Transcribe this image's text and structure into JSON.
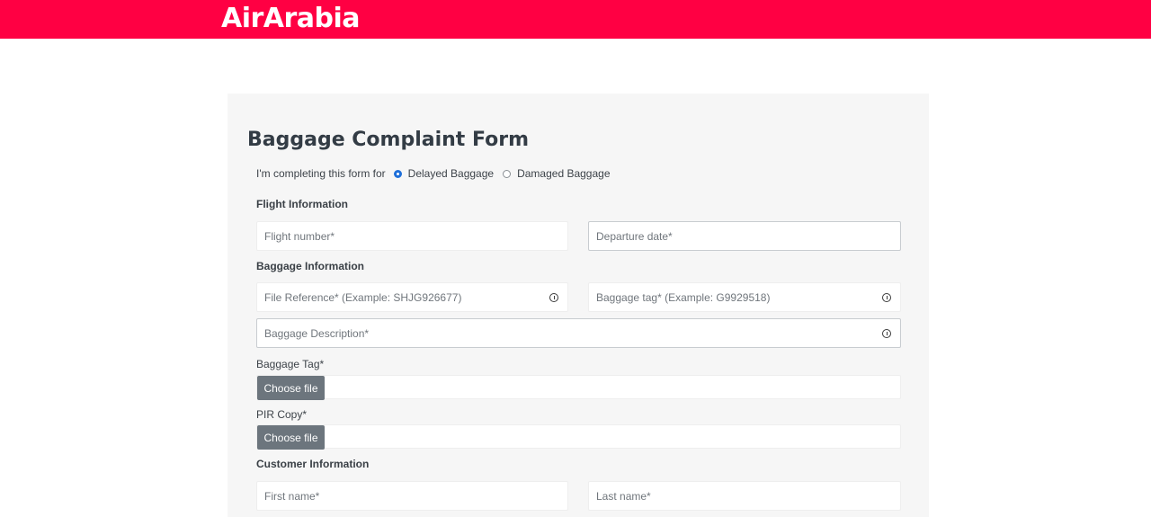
{
  "header": {
    "logo_text": "AirArabia",
    "brand_color": "#ff0043"
  },
  "form": {
    "title": "Baggage Complaint Form",
    "purpose": {
      "label": "I'm completing this form for",
      "options": [
        {
          "label": "Delayed Baggage",
          "selected": true
        },
        {
          "label": "Damaged Baggage",
          "selected": false
        }
      ]
    },
    "flight_section": {
      "title": "Flight Information",
      "flight_number_placeholder": "Flight number*",
      "departure_date_placeholder": "Departure date*"
    },
    "baggage_section": {
      "title": "Baggage Information",
      "file_reference_placeholder": "File Reference* (Example: SHJG926677)",
      "baggage_tag_placeholder": "Baggage tag* (Example: G9929518)",
      "description_placeholder": "Baggage Description*",
      "tag_upload_label": "Baggage Tag*",
      "pir_upload_label": "PIR Copy*",
      "choose_file_label": "Choose file"
    },
    "customer_section": {
      "title": "Customer Information",
      "first_name_placeholder": "First name*",
      "last_name_placeholder": "Last name*"
    }
  }
}
